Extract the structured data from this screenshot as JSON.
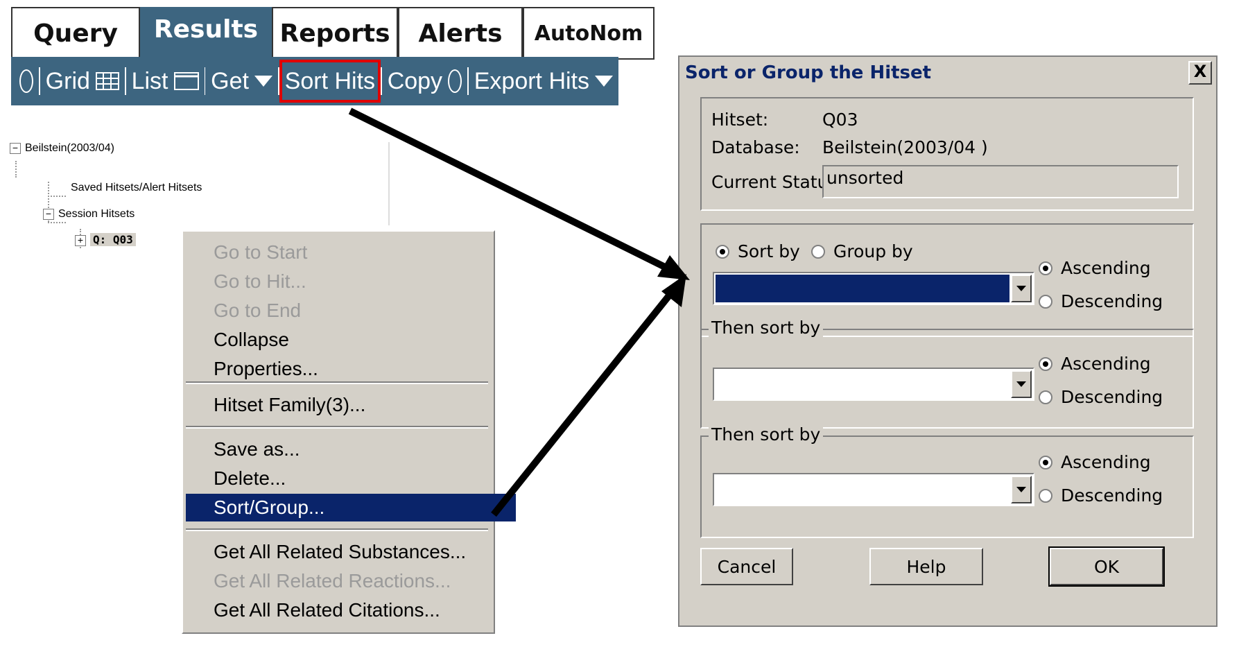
{
  "tabs": [
    {
      "label": "Query",
      "active": false
    },
    {
      "label": "Results",
      "active": true
    },
    {
      "label": "Reports",
      "active": false
    },
    {
      "label": "Alerts",
      "active": false
    },
    {
      "label": "AutoNom",
      "active": false
    }
  ],
  "toolbar": {
    "grid_label": "Grid",
    "list_label": "List",
    "get_label": "Get",
    "sort_hits_label": "Sort Hits",
    "copy_label": "Copy",
    "export_label": "Export Hits"
  },
  "tree": {
    "root": "Beilstein(2003/04)",
    "saved": "Saved Hitsets/Alert Hitsets",
    "session": "Session Hitsets",
    "query": "Q: Q03"
  },
  "context_menu": {
    "items": [
      {
        "label": "Go to Start",
        "enabled": false
      },
      {
        "label": "Go to Hit...",
        "enabled": false
      },
      {
        "label": "Go to End",
        "enabled": false
      },
      {
        "label": "Collapse",
        "enabled": true
      },
      {
        "label": "Properties...",
        "enabled": true
      },
      {
        "label": "Hitset Family(3)...",
        "enabled": true
      },
      {
        "label": "Save as...",
        "enabled": true
      },
      {
        "label": "Delete...",
        "enabled": true
      },
      {
        "label": "Sort/Group...",
        "enabled": true,
        "selected": true
      },
      {
        "label": "Get All Related Substances...",
        "enabled": true
      },
      {
        "label": "Get All Related Reactions...",
        "enabled": false
      },
      {
        "label": "Get All Related Citations...",
        "enabled": true
      }
    ]
  },
  "dialog": {
    "title": "Sort or Group the Hitset",
    "close": "X",
    "hitset_label": "Hitset:",
    "hitset_value": "Q03",
    "database_label": "Database:",
    "database_value": "Beilstein(2003/04 )",
    "status_label": "Current Status:",
    "status_value": "unsorted",
    "sort_by": "Sort by",
    "group_by": "Group by",
    "then_sort_by": "Then sort by",
    "ascending": "Ascending",
    "descending": "Descending",
    "cancel": "Cancel",
    "help": "Help",
    "ok": "OK"
  },
  "colors": {
    "toolbar_bg": "#3d6580",
    "highlight_box": "#e00000",
    "selection": "#0a246a",
    "dialog_bg": "#d4d0c8"
  }
}
